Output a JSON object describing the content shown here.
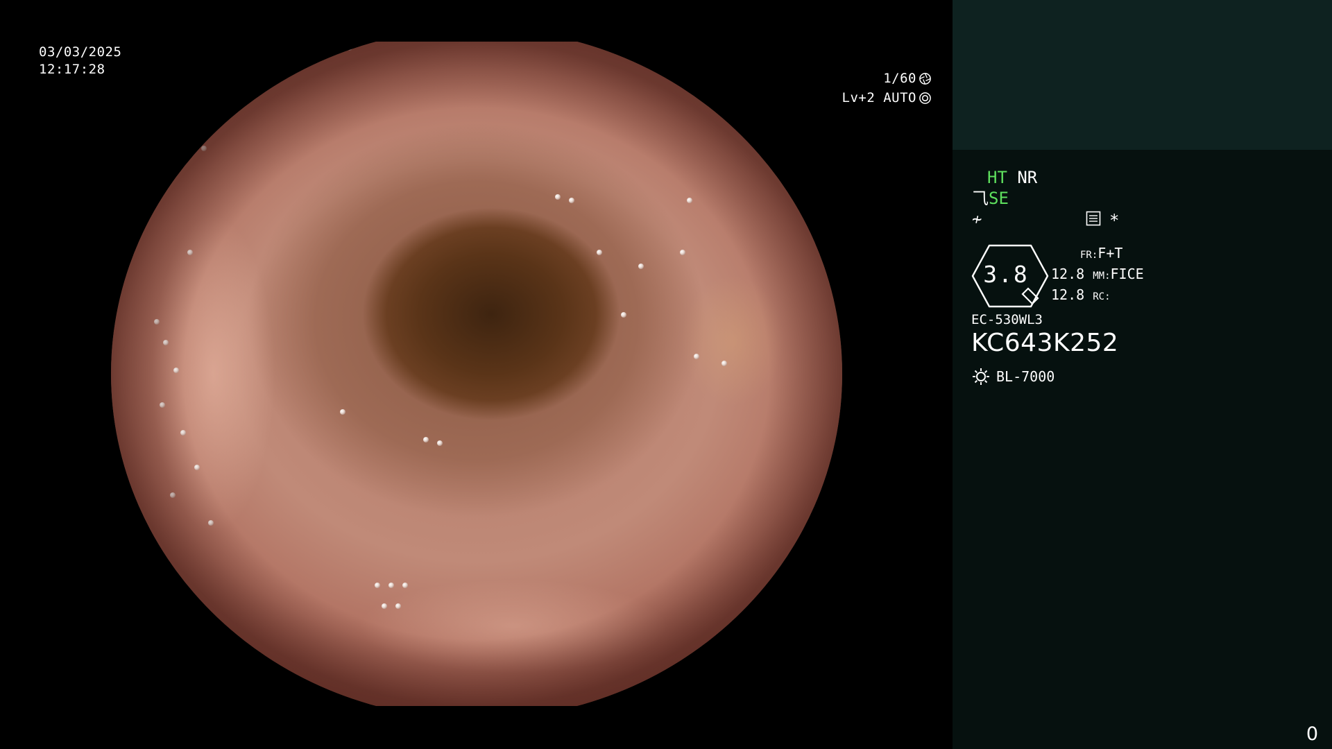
{
  "overlay": {
    "date": "03/03/2025",
    "time": "12:17:28",
    "shutter": "1/60",
    "shutter_icon": "shutter-icon",
    "level": "Lv+2 AUTO",
    "iris_icon": "iris-icon"
  },
  "info": {
    "ht_label": "HT",
    "nr_label": "NR",
    "se_label": "SE",
    "se_icon": "enhance-icon",
    "f_icon": "filter-icon",
    "menu_icon": "menu-icon",
    "asterisk": "*",
    "zoom_value": "3.8",
    "fr_left_1": "12.8",
    "fr_left_2": "12.8",
    "fr_label": "FR:",
    "fr_value": "F+T",
    "mm_label": "MM:",
    "mm_value": "FICE",
    "rc_label": "RC:",
    "scope_model": "EC-530WL3",
    "scope_serial": "KC643K252",
    "light_icon": "lamp-icon",
    "light_source": "BL-7000",
    "counter": "0"
  },
  "colors": {
    "panel_bg": "#06110f",
    "panel_top_bg": "#0e2220",
    "accent_green": "#5ee05e"
  }
}
